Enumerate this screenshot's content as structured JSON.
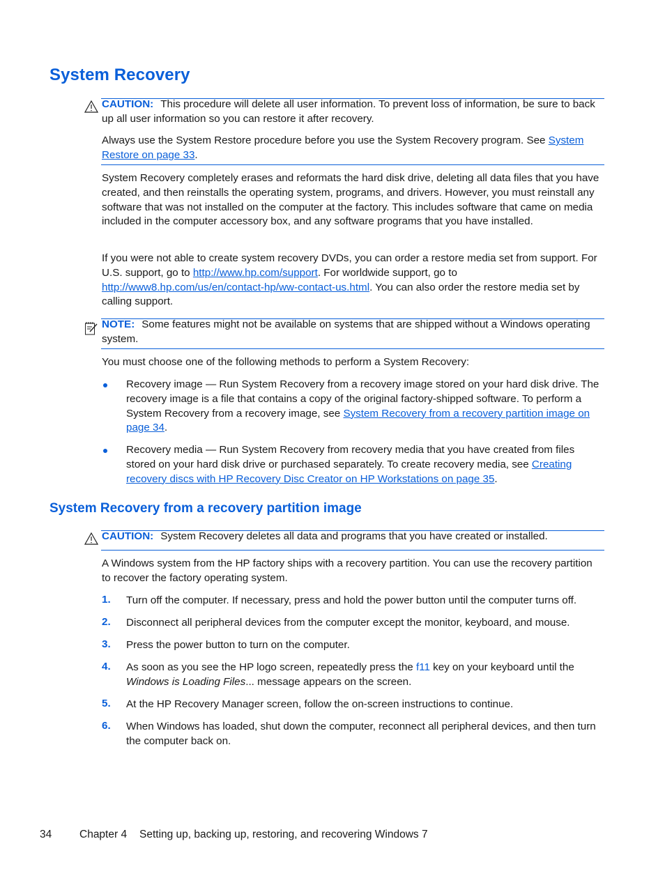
{
  "section_title": "System Recovery",
  "caution1": {
    "label": "CAUTION:",
    "text": "This procedure will delete all user information. To prevent loss of information, be sure to back up all user information so you can restore it after recovery.",
    "para_prefix": "Always use the System Restore procedure before you use the System Recovery program. See ",
    "para_link": "System Restore on page 33",
    "para_suffix": "."
  },
  "para_erase": "System Recovery completely erases and reformats the hard disk drive, deleting all data files that you have created, and then reinstalls the operating system, programs, and drivers. However, you must reinstall any software that was not installed on the computer at the factory. This includes software that came on media included in the computer accessory box, and any software programs that you have installed.",
  "para_dvd": {
    "t1": "If you were not able to create system recovery DVDs, you can order a restore media set from support. For U.S. support, go to ",
    "link1": "http://www.hp.com/support",
    "t2": ". For worldwide support, go to ",
    "link2": "http://www8.hp.com/us/en/contact-hp/ww-contact-us.html",
    "t3": ". You can also order the restore media set by calling support."
  },
  "note": {
    "label": "NOTE:",
    "text": "Some features might not be available on systems that are shipped without a Windows operating system."
  },
  "methods_intro": "You must choose one of the following methods to perform a System Recovery:",
  "methods": [
    {
      "text": "Recovery image — Run System Recovery from a recovery image stored on your hard disk drive. The recovery image is a file that contains a copy of the original factory-shipped software. To perform a System Recovery from a recovery image, see ",
      "link": "System Recovery from a recovery partition image on page 34",
      "suffix": "."
    },
    {
      "text": "Recovery media — Run System Recovery from recovery media that you have created from files stored on your hard disk drive or purchased separately. To create recovery media, see ",
      "link": "Creating recovery discs with HP Recovery Disc Creator on HP Workstations on page 35",
      "suffix": "."
    }
  ],
  "subsection_title": "System Recovery from a recovery partition image",
  "caution2": {
    "label": "CAUTION:",
    "text": "System Recovery deletes all data and programs that you have created or installed."
  },
  "partition_intro": "A Windows system from the HP factory ships with a recovery partition. You can use the recovery partition to recover the factory operating system.",
  "steps": [
    {
      "num": "1.",
      "text": "Turn off the computer. If necessary, press and hold the power button until the computer turns off."
    },
    {
      "num": "2.",
      "text": "Disconnect all peripheral devices from the computer except the monitor, keyboard, and mouse."
    },
    {
      "num": "3.",
      "text": "Press the power button to turn on the computer."
    },
    {
      "num": "4.",
      "t1": "As soon as you see the HP logo screen, repeatedly press the ",
      "key": "f11",
      "t2": " key on your keyboard until the ",
      "italic": "Windows is Loading Files",
      "t3": "... message appears on the screen."
    },
    {
      "num": "5.",
      "text": "At the HP Recovery Manager screen, follow the on-screen instructions to continue."
    },
    {
      "num": "6.",
      "text": "When Windows has loaded, shut down the computer, reconnect all peripheral devices, and then turn the computer back on."
    }
  ],
  "footer": {
    "page": "34",
    "chapter": "Chapter 4",
    "chapter_title": "Setting up, backing up, restoring, and recovering Windows 7"
  }
}
